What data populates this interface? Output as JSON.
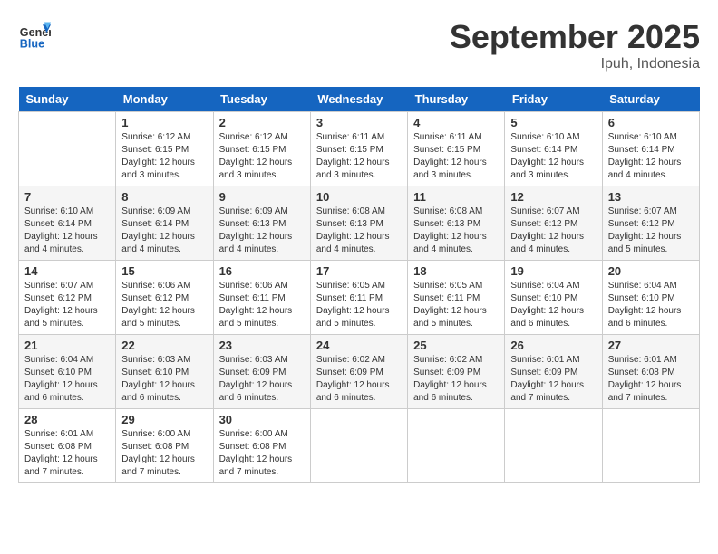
{
  "header": {
    "logo_line1": "General",
    "logo_line2": "Blue",
    "month": "September 2025",
    "location": "Ipuh, Indonesia"
  },
  "weekdays": [
    "Sunday",
    "Monday",
    "Tuesday",
    "Wednesday",
    "Thursday",
    "Friday",
    "Saturday"
  ],
  "weeks": [
    [
      {
        "day": "",
        "info": ""
      },
      {
        "day": "1",
        "info": "Sunrise: 6:12 AM\nSunset: 6:15 PM\nDaylight: 12 hours\nand 3 minutes."
      },
      {
        "day": "2",
        "info": "Sunrise: 6:12 AM\nSunset: 6:15 PM\nDaylight: 12 hours\nand 3 minutes."
      },
      {
        "day": "3",
        "info": "Sunrise: 6:11 AM\nSunset: 6:15 PM\nDaylight: 12 hours\nand 3 minutes."
      },
      {
        "day": "4",
        "info": "Sunrise: 6:11 AM\nSunset: 6:15 PM\nDaylight: 12 hours\nand 3 minutes."
      },
      {
        "day": "5",
        "info": "Sunrise: 6:10 AM\nSunset: 6:14 PM\nDaylight: 12 hours\nand 3 minutes."
      },
      {
        "day": "6",
        "info": "Sunrise: 6:10 AM\nSunset: 6:14 PM\nDaylight: 12 hours\nand 4 minutes."
      }
    ],
    [
      {
        "day": "7",
        "info": "Sunrise: 6:10 AM\nSunset: 6:14 PM\nDaylight: 12 hours\nand 4 minutes."
      },
      {
        "day": "8",
        "info": "Sunrise: 6:09 AM\nSunset: 6:14 PM\nDaylight: 12 hours\nand 4 minutes."
      },
      {
        "day": "9",
        "info": "Sunrise: 6:09 AM\nSunset: 6:13 PM\nDaylight: 12 hours\nand 4 minutes."
      },
      {
        "day": "10",
        "info": "Sunrise: 6:08 AM\nSunset: 6:13 PM\nDaylight: 12 hours\nand 4 minutes."
      },
      {
        "day": "11",
        "info": "Sunrise: 6:08 AM\nSunset: 6:13 PM\nDaylight: 12 hours\nand 4 minutes."
      },
      {
        "day": "12",
        "info": "Sunrise: 6:07 AM\nSunset: 6:12 PM\nDaylight: 12 hours\nand 4 minutes."
      },
      {
        "day": "13",
        "info": "Sunrise: 6:07 AM\nSunset: 6:12 PM\nDaylight: 12 hours\nand 5 minutes."
      }
    ],
    [
      {
        "day": "14",
        "info": "Sunrise: 6:07 AM\nSunset: 6:12 PM\nDaylight: 12 hours\nand 5 minutes."
      },
      {
        "day": "15",
        "info": "Sunrise: 6:06 AM\nSunset: 6:12 PM\nDaylight: 12 hours\nand 5 minutes."
      },
      {
        "day": "16",
        "info": "Sunrise: 6:06 AM\nSunset: 6:11 PM\nDaylight: 12 hours\nand 5 minutes."
      },
      {
        "day": "17",
        "info": "Sunrise: 6:05 AM\nSunset: 6:11 PM\nDaylight: 12 hours\nand 5 minutes."
      },
      {
        "day": "18",
        "info": "Sunrise: 6:05 AM\nSunset: 6:11 PM\nDaylight: 12 hours\nand 5 minutes."
      },
      {
        "day": "19",
        "info": "Sunrise: 6:04 AM\nSunset: 6:10 PM\nDaylight: 12 hours\nand 6 minutes."
      },
      {
        "day": "20",
        "info": "Sunrise: 6:04 AM\nSunset: 6:10 PM\nDaylight: 12 hours\nand 6 minutes."
      }
    ],
    [
      {
        "day": "21",
        "info": "Sunrise: 6:04 AM\nSunset: 6:10 PM\nDaylight: 12 hours\nand 6 minutes."
      },
      {
        "day": "22",
        "info": "Sunrise: 6:03 AM\nSunset: 6:10 PM\nDaylight: 12 hours\nand 6 minutes."
      },
      {
        "day": "23",
        "info": "Sunrise: 6:03 AM\nSunset: 6:09 PM\nDaylight: 12 hours\nand 6 minutes."
      },
      {
        "day": "24",
        "info": "Sunrise: 6:02 AM\nSunset: 6:09 PM\nDaylight: 12 hours\nand 6 minutes."
      },
      {
        "day": "25",
        "info": "Sunrise: 6:02 AM\nSunset: 6:09 PM\nDaylight: 12 hours\nand 6 minutes."
      },
      {
        "day": "26",
        "info": "Sunrise: 6:01 AM\nSunset: 6:09 PM\nDaylight: 12 hours\nand 7 minutes."
      },
      {
        "day": "27",
        "info": "Sunrise: 6:01 AM\nSunset: 6:08 PM\nDaylight: 12 hours\nand 7 minutes."
      }
    ],
    [
      {
        "day": "28",
        "info": "Sunrise: 6:01 AM\nSunset: 6:08 PM\nDaylight: 12 hours\nand 7 minutes."
      },
      {
        "day": "29",
        "info": "Sunrise: 6:00 AM\nSunset: 6:08 PM\nDaylight: 12 hours\nand 7 minutes."
      },
      {
        "day": "30",
        "info": "Sunrise: 6:00 AM\nSunset: 6:08 PM\nDaylight: 12 hours\nand 7 minutes."
      },
      {
        "day": "",
        "info": ""
      },
      {
        "day": "",
        "info": ""
      },
      {
        "day": "",
        "info": ""
      },
      {
        "day": "",
        "info": ""
      }
    ]
  ]
}
